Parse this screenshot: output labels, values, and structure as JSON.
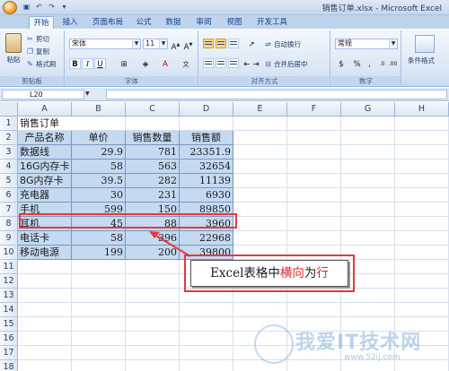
{
  "window": {
    "title": "销售订单.xlsx - Microsoft Excel"
  },
  "ribbon": {
    "tabs": [
      "开始",
      "插入",
      "页面布局",
      "公式",
      "数据",
      "审阅",
      "视图",
      "开发工具"
    ],
    "active_tab": "开始",
    "clipboard": {
      "paste": "粘贴",
      "cut": "剪切",
      "copy": "复制",
      "format_painter": "格式刷",
      "group_label": "剪贴板"
    },
    "font": {
      "name": "宋体",
      "size": "11",
      "group_label": "字体"
    },
    "alignment": {
      "wrap_text": "自动换行",
      "merge_center": "合并后居中",
      "group_label": "对齐方式"
    },
    "number": {
      "format": "常规",
      "percent": "%",
      "comma": ",",
      "group_label": "数字"
    },
    "styles": {
      "conditional_format": "条件格式"
    }
  },
  "formula_bar": {
    "name_box": "L20"
  },
  "sheet": {
    "columns": [
      "A",
      "B",
      "C",
      "D",
      "E",
      "F",
      "G",
      "H"
    ],
    "rows": [
      "1",
      "2",
      "3",
      "4",
      "5",
      "6",
      "7",
      "8",
      "9",
      "10",
      "11",
      "12",
      "13",
      "14",
      "15",
      "16",
      "17",
      "18"
    ],
    "title": "销售订单",
    "headers": [
      "产品名称",
      "单价",
      "销售数量",
      "销售额"
    ],
    "data": [
      [
        "数据线",
        "29.9",
        "781",
        "23351.9"
      ],
      [
        "16G内存卡",
        "58",
        "563",
        "32654"
      ],
      [
        "8G内存卡",
        "39.5",
        "282",
        "11139"
      ],
      [
        "充电器",
        "30",
        "231",
        "6930"
      ],
      [
        "手机",
        "599",
        "150",
        "89850"
      ],
      [
        "耳机",
        "45",
        "88",
        "3960"
      ],
      [
        "电话卡",
        "58",
        "396",
        "22968"
      ],
      [
        "移动电源",
        "199",
        "200",
        "39800"
      ]
    ],
    "highlighted_row": "8"
  },
  "annotation": {
    "prefix": "Excel表格中",
    "highlight1": "横向",
    "middle": "为",
    "highlight2": "行"
  },
  "watermark": {
    "text": "我爱IT技术网",
    "sub": "www.52ij.com"
  },
  "colors": {
    "table_fill": "#c5d9f1",
    "highlight": "#e33a3a"
  }
}
